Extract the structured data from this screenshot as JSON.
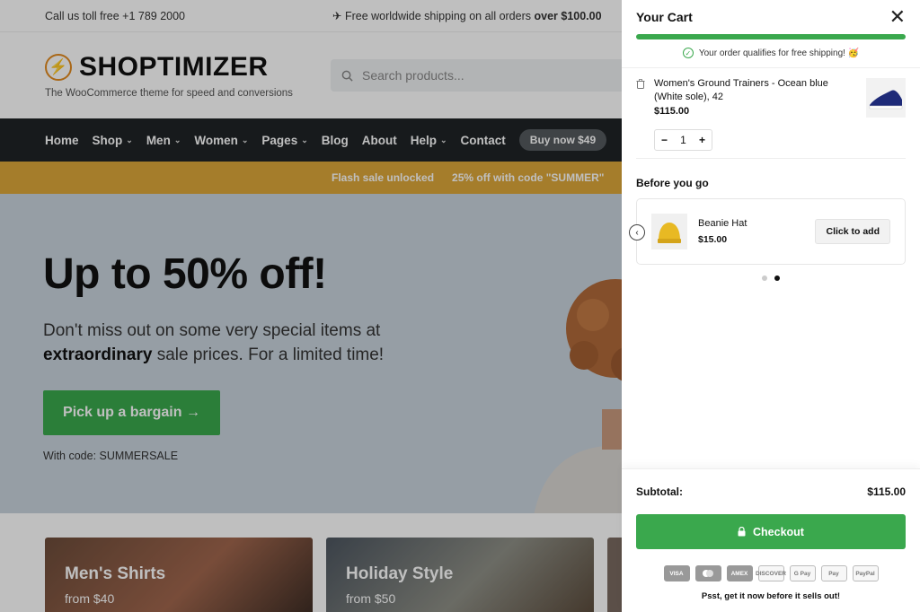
{
  "topbar": {
    "phone": "Call us toll free +1 789 2000",
    "shipping_prefix": "✈ Free worldwide shipping on all orders ",
    "shipping_amount": "over $100.00"
  },
  "brand": {
    "name": "SHOPTIMIZER",
    "tagline": "The WooCommerce theme for speed and conversions"
  },
  "search": {
    "placeholder": "Search products..."
  },
  "nav": {
    "items": [
      {
        "label": "Home",
        "dropdown": false
      },
      {
        "label": "Shop",
        "dropdown": true
      },
      {
        "label": "Men",
        "dropdown": true
      },
      {
        "label": "Women",
        "dropdown": true
      },
      {
        "label": "Pages",
        "dropdown": true
      },
      {
        "label": "Blog",
        "dropdown": false
      },
      {
        "label": "About",
        "dropdown": false
      },
      {
        "label": "Help",
        "dropdown": true
      },
      {
        "label": "Contact",
        "dropdown": false
      }
    ],
    "buy_label": "Buy now $49"
  },
  "promo": {
    "left": "Flash sale unlocked",
    "right": "25% off with code \"SUMMER\""
  },
  "hero": {
    "title": "Up to 50% off!",
    "text_1": "Don't miss out on some very special items at ",
    "text_bold": "extraordinary",
    "text_2": " sale prices. For a limited time!",
    "button": "Pick up a bargain →",
    "code": "With code: SUMMERSALE"
  },
  "cards": [
    {
      "title": "Men's Shirts",
      "sub": "from $40"
    },
    {
      "title": "Holiday Style",
      "sub": "from $50"
    }
  ],
  "cart": {
    "title": "Your Cart",
    "free_shipping_msg": "Your order qualifies for free shipping! 🥳",
    "progress": 1.0,
    "item": {
      "name": "Women's Ground Trainers - Ocean blue (White sole), 42",
      "price": "$115.00",
      "qty": "1",
      "minus": "−",
      "plus": "+"
    },
    "upsell": {
      "title": "Before you go",
      "name": "Beanie Hat",
      "price": "$15.00",
      "add_label": "Click to add"
    },
    "subtotal_label": "Subtotal:",
    "subtotal_value": "$115.00",
    "checkout_label": "Checkout",
    "payments": [
      "VISA",
      "MC",
      "AMEX",
      "DISCOVER",
      "G Pay",
      "Pay",
      "PayPal"
    ],
    "footer_msg": "Psst, get it now before it sells out!"
  },
  "colors": {
    "accent_green": "#3aa84d",
    "nav_bg": "#1f2326",
    "promo_bg": "#dca73a",
    "logo_orange": "#e28a1f"
  }
}
